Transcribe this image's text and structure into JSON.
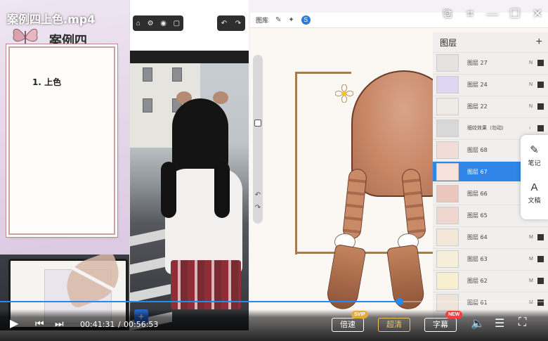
{
  "video": {
    "title": "案例四上色.mp4",
    "current_time": "00:41:31",
    "total_time": "00:56:53",
    "progress": 0.7298
  },
  "window_controls": {
    "icons": [
      "pip-icon",
      "crop-icon",
      "minimize-icon",
      "maximize-icon",
      "close-icon"
    ]
  },
  "lesson": {
    "heading": "案例四",
    "step": "1. 上色"
  },
  "reference": {
    "toolbar_icons": [
      "home-icon",
      "settings-icon",
      "eye-icon",
      "lock-icon"
    ],
    "undo_icons": [
      "undo-icon",
      "redo-icon"
    ]
  },
  "app": {
    "gallery_label": "图库",
    "active_tool_letter": "S"
  },
  "layers": {
    "title": "图层",
    "add_symbol": "+",
    "items": [
      {
        "name": "图层 27",
        "mode": "N",
        "visible": true,
        "active": false,
        "group": false
      },
      {
        "name": "图层 24",
        "mode": "N",
        "visible": true,
        "active": false,
        "group": false
      },
      {
        "name": "图层 22",
        "mode": "N",
        "visible": true,
        "active": false,
        "group": false
      },
      {
        "name": "细纹效果（勿动）",
        "mode": "›",
        "visible": true,
        "active": false,
        "group": true
      },
      {
        "name": "图层 68",
        "mode": "N",
        "visible": true,
        "active": false,
        "group": false
      },
      {
        "name": "图层 67",
        "mode": "N",
        "visible": true,
        "active": true,
        "group": false
      },
      {
        "name": "图层 66",
        "mode": "N",
        "visible": true,
        "active": false,
        "group": false
      },
      {
        "name": "图层 65",
        "mode": "N",
        "visible": true,
        "active": false,
        "group": false
      },
      {
        "name": "图层 64",
        "mode": "M",
        "visible": true,
        "active": false,
        "group": false
      },
      {
        "name": "图层 63",
        "mode": "M",
        "visible": true,
        "active": false,
        "group": false
      },
      {
        "name": "图层 62",
        "mode": "M",
        "visible": true,
        "active": false,
        "group": false
      },
      {
        "name": "图层 61",
        "mode": "M",
        "visible": true,
        "active": false,
        "group": false
      }
    ]
  },
  "dock": {
    "notes_label": "笔记",
    "transcript_label": "文稿"
  },
  "player": {
    "speed_label": "倍速",
    "speed_badge": "SVIP",
    "quality_label": "超清",
    "subtitle_label": "字幕",
    "subtitle_badge": "NEW",
    "accent_color": "#1f8bff",
    "badge_svip_color": "#e6a93a",
    "badge_new_color": "#ff3b3b"
  }
}
